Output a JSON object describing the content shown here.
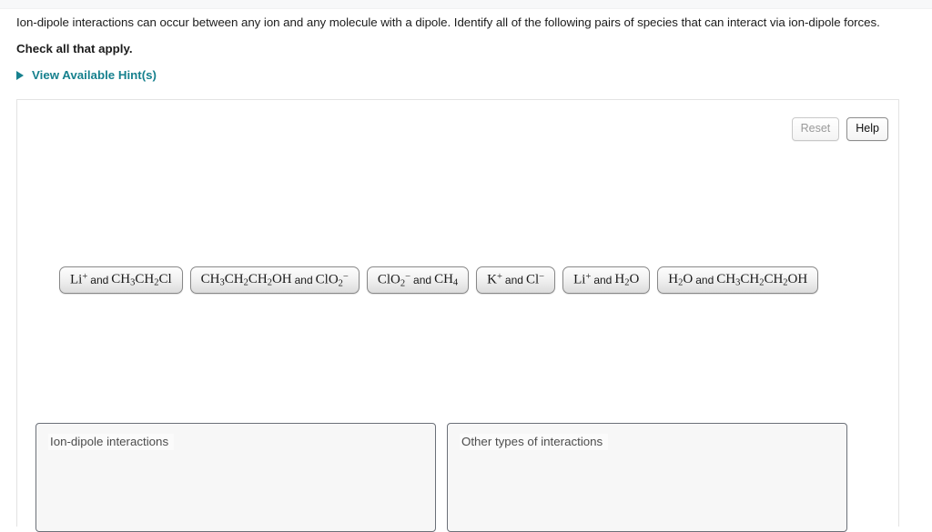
{
  "prompt": "Ion-dipole interactions can occur between any ion and any molecule with a dipole. Identify all of the following pairs of species that can interact via ion-dipole forces.",
  "instruction": "Check all that apply.",
  "hints": {
    "label": "View Available Hint(s)",
    "icon": "triangle-right-icon",
    "color": "#17818e"
  },
  "toolbar": {
    "reset_label": "Reset",
    "help_label": "Help"
  },
  "tiles": [
    {
      "id": "tile-1",
      "parts": [
        {
          "type": "formula",
          "text": "Li",
          "sup": "+"
        },
        {
          "type": "conj",
          "text": "and"
        },
        {
          "type": "formula",
          "text": "CH",
          "sub": "3",
          "text2": "CH",
          "sub2": "2",
          "text3": "Cl"
        }
      ],
      "plain": "Li+ and CH3CH2Cl"
    },
    {
      "id": "tile-2",
      "plain": "CH3CH2CH2OH and ClO2-"
    },
    {
      "id": "tile-3",
      "plain": "ClO2- and CH4"
    },
    {
      "id": "tile-4",
      "plain": "K+ and Cl-"
    },
    {
      "id": "tile-5",
      "plain": "Li+ and H2O"
    },
    {
      "id": "tile-6",
      "plain": "H2O and CH3CH2CH2OH"
    }
  ],
  "bins": [
    {
      "id": "bin-ion-dipole",
      "title": "Ion-dipole interactions",
      "items": []
    },
    {
      "id": "bin-other",
      "title": "Other types of interactions",
      "items": []
    }
  ]
}
